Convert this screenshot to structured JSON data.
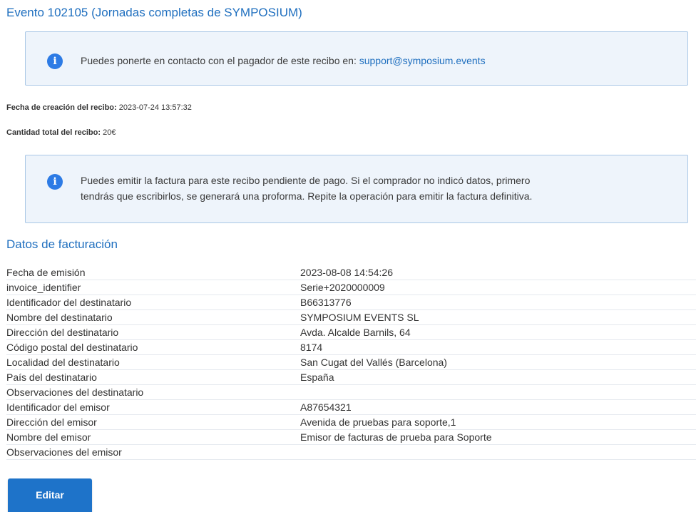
{
  "event": {
    "title": "Evento 102105 (Jornadas completas de SYMPOSIUM)"
  },
  "contact_notice": {
    "icon": "info-icon",
    "text": "Puedes ponerte en contacto con el pagador de este recibo en: ",
    "email": "support@symposium.events"
  },
  "receipt": {
    "created_label": "Fecha de creación del recibo:",
    "created_value": "2023-07-24 13:57:32",
    "total_label": "Cantidad total del recibo:",
    "total_value": "20€"
  },
  "invoice_notice": {
    "icon": "info-icon",
    "line1": "Puedes emitir la factura para este recibo pendiente de pago. Si el comprador no indicó datos, primero",
    "line2": "tendrás que escribirlos, se generará una proforma. Repite la operación para emitir la factura definitiva."
  },
  "billing": {
    "title": "Datos de facturación",
    "rows": [
      {
        "label": "Fecha de emisión",
        "value": "2023-08-08 14:54:26"
      },
      {
        "label": "invoice_identifier",
        "value": "Serie+2020000009"
      },
      {
        "label": "Identificador del destinatario",
        "value": "B66313776"
      },
      {
        "label": "Nombre del destinatario",
        "value": "SYMPOSIUM EVENTS SL"
      },
      {
        "label": "Dirección del destinatario",
        "value": "Avda. Alcalde Barnils, 64"
      },
      {
        "label": "Código postal del destinatario",
        "value": "8174"
      },
      {
        "label": "Localidad del destinatario",
        "value": "San Cugat del Vallés (Barcelona)"
      },
      {
        "label": "País del destinatario",
        "value": "España"
      },
      {
        "label": "Observaciones del destinatario",
        "value": ""
      },
      {
        "label": "Identificador del emisor",
        "value": "A87654321"
      },
      {
        "label": "Dirección del emisor",
        "value": "Avenida de pruebas para soporte,1"
      },
      {
        "label": "Nombre del emisor",
        "value": "Emisor de facturas de prueba para Soporte"
      },
      {
        "label": "Observaciones del emisor",
        "value": ""
      }
    ]
  },
  "actions": {
    "edit_label": "Editar"
  },
  "colors": {
    "accent": "#1f6fbf",
    "info_bg": "#eef4fb",
    "info_border": "#a9c7e6",
    "button_bg": "#1e73c9"
  }
}
